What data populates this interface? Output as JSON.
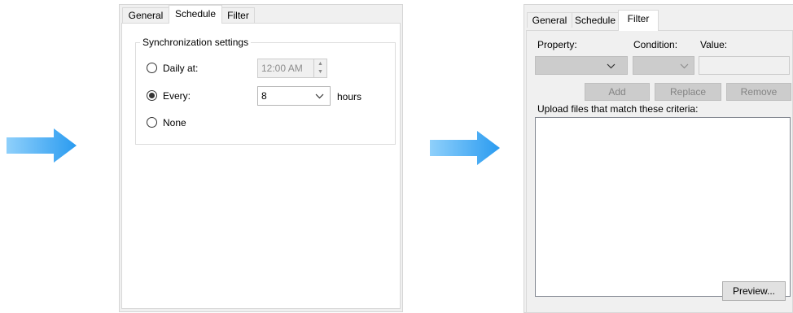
{
  "colors": {
    "arrow_light": "#8fd0fb",
    "arrow_dark": "#2a9bf0",
    "panel_bg": "#f0f0f0",
    "tab_body_bg": "#ffffff",
    "disabled_button": "#cccccc"
  },
  "schedule_dialog": {
    "tabs": [
      "General",
      "Schedule",
      "Filter"
    ],
    "active_tab": "Schedule",
    "group_label": "Synchronization settings",
    "daily": {
      "label": "Daily at:",
      "time_value": "12:00 AM",
      "selected": false
    },
    "every": {
      "label": "Every:",
      "value": "8",
      "unit": "hours",
      "selected": true
    },
    "none": {
      "label": "None",
      "selected": false
    }
  },
  "filter_dialog": {
    "tabs": [
      "General",
      "Schedule",
      "Filter"
    ],
    "active_tab": "Filter",
    "property_label": "Property:",
    "condition_label": "Condition:",
    "value_label": "Value:",
    "add_label": "Add",
    "replace_label": "Replace",
    "remove_label": "Remove",
    "criteria_label": "Upload files that match these criteria:",
    "preview_label": "Preview..."
  },
  "icons": {
    "arrow": "right-arrow-icon",
    "dropdown": "chevron-down-icon",
    "spin_up": "spin-up-icon",
    "spin_down": "spin-down-icon"
  }
}
